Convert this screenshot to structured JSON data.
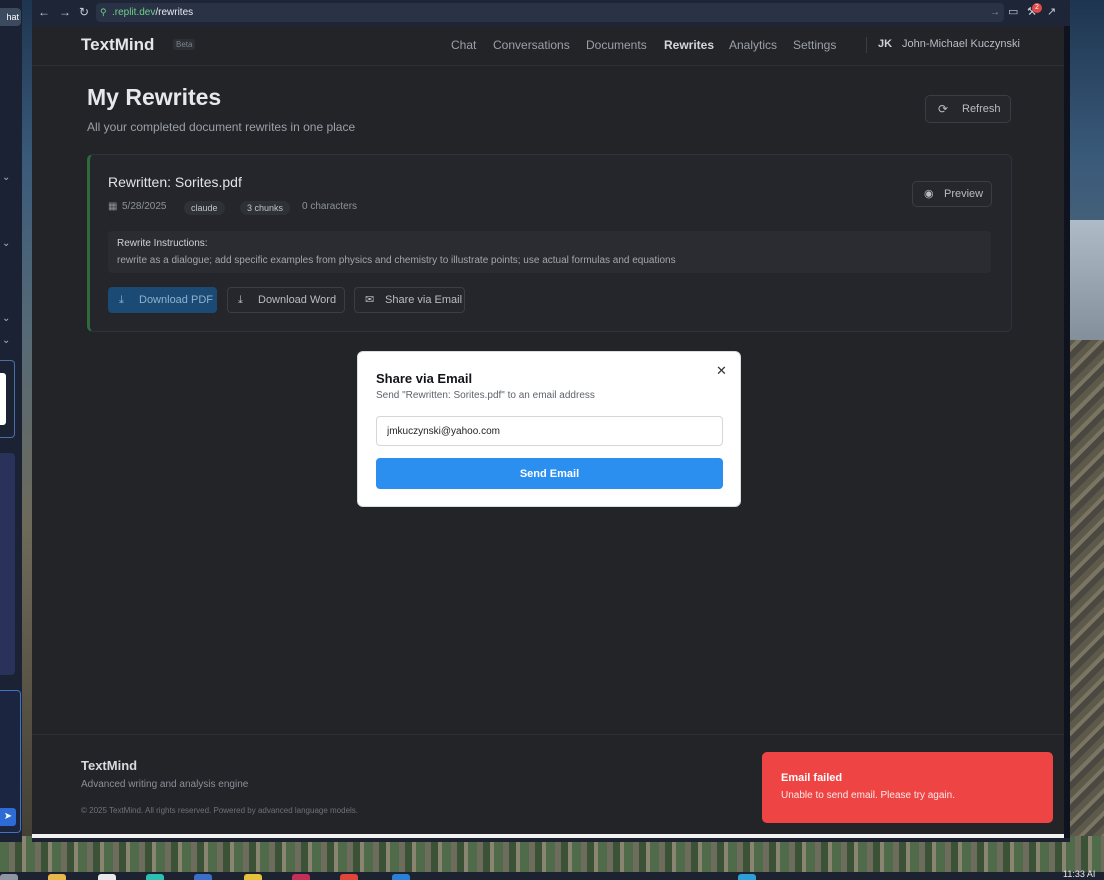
{
  "left_app": {
    "tab_label": "hat",
    "send_icon": "send-icon"
  },
  "browser": {
    "url_host": ".replit.dev",
    "url_path": "/rewrites",
    "notification_count": "2"
  },
  "header": {
    "brand": "TextMind",
    "badge": "Beta",
    "nav": [
      "Chat",
      "Conversations",
      "Documents",
      "Rewrites",
      "Analytics",
      "Settings"
    ],
    "active_nav": "Rewrites",
    "avatar_initials": "JK",
    "user_name": "John-Michael Kuczynski"
  },
  "main": {
    "title": "My Rewrites",
    "subtitle": "All your completed document rewrites in one place",
    "refresh_label": "Refresh"
  },
  "card": {
    "title": "Rewritten: Sorites.pdf",
    "date": "5/28/2025",
    "model": "claude",
    "chunks": "3 chunks",
    "characters": "0 characters",
    "preview_label": "Preview",
    "instructions_label": "Rewrite Instructions:",
    "instructions_text": "rewrite as a dialogue; add specific examples from physics and chemistry to illustrate points; use actual formulas and equations",
    "download_pdf_label": "Download PDF",
    "download_word_label": "Download Word",
    "share_label": "Share via Email"
  },
  "footer": {
    "brand": "TextMind",
    "tagline": "Advanced writing and analysis engine",
    "copyright": "© 2025 TextMind. All rights reserved. Powered by advanced language models."
  },
  "modal": {
    "title": "Share via Email",
    "description": "Send \"Rewritten: Sorites.pdf\" to an email address",
    "email_value": "jmkuczynski@yahoo.com",
    "send_label": "Send Email"
  },
  "toast": {
    "title": "Email failed",
    "message": "Unable to send email. Please try again."
  },
  "system": {
    "clock": "11:33 AI"
  },
  "colors": {
    "primary_button": "#2b8ff0",
    "toast_error": "#ef4444",
    "card_accent": "#2f6b3a"
  }
}
